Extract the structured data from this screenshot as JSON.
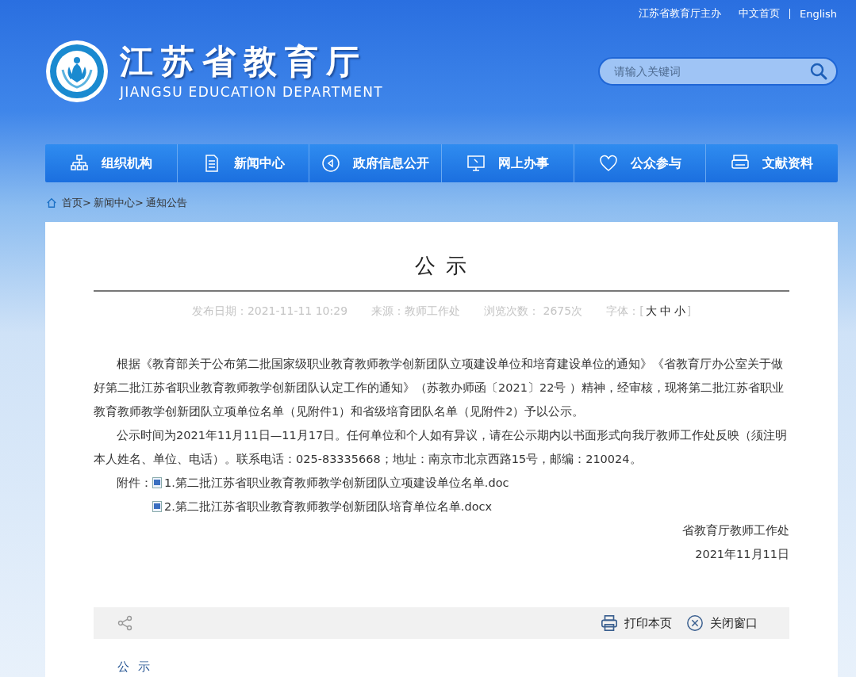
{
  "top_links": [
    "江苏省教育厅主办",
    "中文首页",
    "English"
  ],
  "site": {
    "title": "江苏省教育厅",
    "subtitle": "JIANGSU EDUCATION DEPARTMENT"
  },
  "search": {
    "placeholder": "请输入关键词"
  },
  "nav": [
    {
      "label": "组织机构"
    },
    {
      "label": "新闻中心"
    },
    {
      "label": "政府信息公开"
    },
    {
      "label": "网上办事"
    },
    {
      "label": "公众参与"
    },
    {
      "label": "文献资料"
    }
  ],
  "breadcrumb": [
    "首页>",
    "新闻中心>",
    "通知公告"
  ],
  "article": {
    "title": "公 示",
    "meta": {
      "date": "发布日期：2021-11-11 10:29",
      "source": "来源：教师工作处",
      "views": "浏览次数： 2675次",
      "font_label": "字体：",
      "bracket_open": "[",
      "font_sizes": [
        "大",
        "中",
        "小"
      ],
      "bracket_close": "]"
    },
    "paragraphs": [
      "根据《教育部关于公布第二批国家级职业教育教师教学创新团队立项建设单位和培育建设单位的通知》《省教育厅办公室关于做好第二批江苏省职业教育教师教学创新团队认定工作的通知》（苏教办师函〔2021〕22号 ）精神，经审核，现将第二批江苏省职业教育教师教学创新团队立项单位名单（见附件1）和省级培育团队名单（见附件2）予以公示。",
      "公示时间为2021年11月11日—11月17日。任何单位和个人如有异议，请在公示期内以书面形式向我厅教师工作处反映（须注明本人姓名、单位、电话）。联系电话：025-83335668；地址：南京市北京西路15号，邮编：210024。"
    ],
    "attachment_label": "附件：",
    "attachments": [
      "1.第二批江苏省职业教育教师教学创新团队立项建设单位名单.doc",
      "2.第二批江苏省职业教育教师教学创新团队培育单位名单.docx"
    ],
    "signature": "省教育厅教师工作处",
    "sign_date": "2021年11月11日"
  },
  "toolbar": {
    "print": "打印本页",
    "close": "关闭窗口"
  },
  "related_title": "公 示"
}
